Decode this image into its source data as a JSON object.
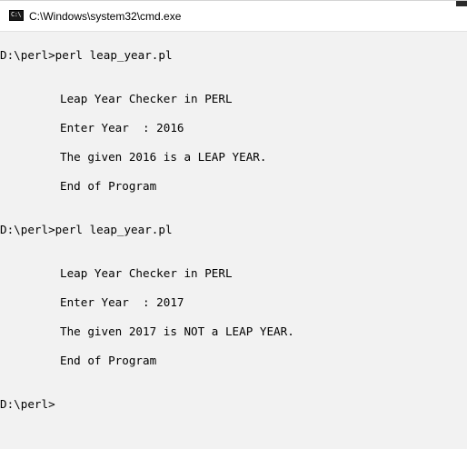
{
  "window": {
    "title": "C:\\Windows\\system32\\cmd.exe",
    "icon": "cmd-console-icon",
    "icon_glyph": "C:\\"
  },
  "console": {
    "lines": [
      "D:\\perl>perl leap_year.pl",
      "Leap Year Checker in PERL",
      "Enter Year  : 2016",
      "The given 2016 is a LEAP YEAR.",
      "End of Program",
      "D:\\perl>perl leap_year.pl",
      "Leap Year Checker in PERL",
      "Enter Year  : 2017",
      "The given 2017 is NOT a LEAP YEAR.",
      "End of Program",
      "D:\\perl>"
    ]
  }
}
